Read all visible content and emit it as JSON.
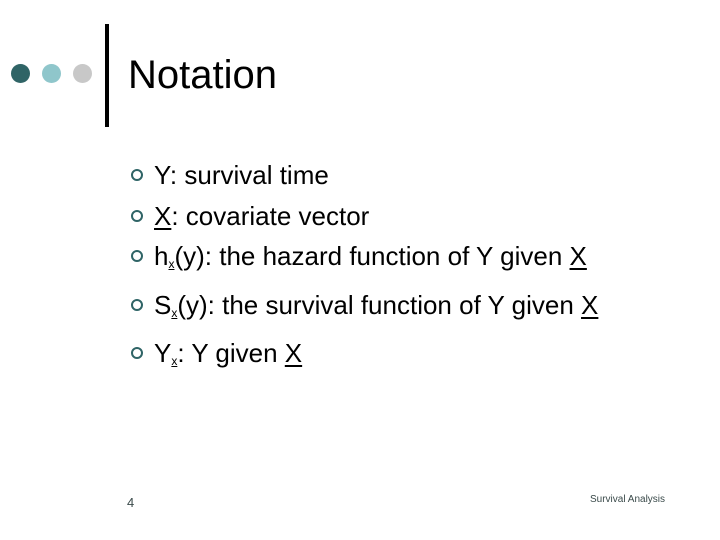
{
  "slide": {
    "title": "Notation",
    "decor_colors": [
      "#2f6466",
      "#8fc6cb",
      "#c8c8c8"
    ],
    "bullet_color": "#2f6466",
    "bullets": [
      {
        "parts": [
          {
            "text": "Y: survival time"
          }
        ]
      },
      {
        "parts": [
          {
            "text": "X",
            "style": "underline"
          },
          {
            "text": ": covariate vector"
          }
        ]
      },
      {
        "parts": [
          {
            "text": "h"
          },
          {
            "text": "x",
            "style": "sub"
          },
          {
            "text": "(y): the hazard function of Y given "
          },
          {
            "text": "X",
            "style": "underline"
          }
        ]
      },
      {
        "parts": [
          {
            "text": "S"
          },
          {
            "text": "x",
            "style": "sub"
          },
          {
            "text": "(y): the survival function of Y given "
          },
          {
            "text": "X",
            "style": "underline"
          }
        ]
      },
      {
        "parts": [
          {
            "text": "Y"
          },
          {
            "text": "x",
            "style": "sub"
          },
          {
            "text": ": Y given "
          },
          {
            "text": "X",
            "style": "underline"
          }
        ]
      }
    ],
    "page_number": "4",
    "footer": "Survival Analysis"
  }
}
